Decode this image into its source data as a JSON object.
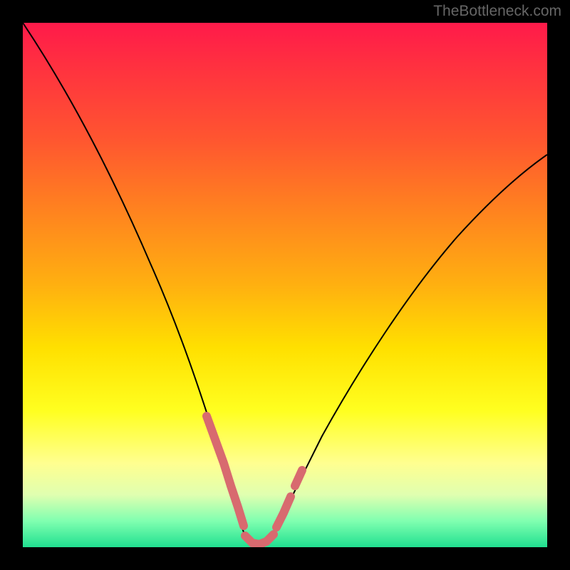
{
  "watermark": "TheBottleneck.com",
  "chart_data": {
    "type": "line",
    "title": "",
    "xlabel": "",
    "ylabel": "",
    "xlim": [
      0,
      100
    ],
    "ylim": [
      0,
      100
    ],
    "grid": false,
    "series": [
      {
        "name": "bottleneck-curve",
        "x": [
          0,
          5,
          10,
          15,
          20,
          25,
          28,
          30,
          32,
          34,
          36,
          38,
          40,
          42,
          44,
          46,
          50,
          55,
          60,
          65,
          70,
          75,
          80,
          85,
          90,
          95,
          100
        ],
        "y": [
          100,
          90,
          79,
          68,
          56,
          43,
          34,
          28,
          22,
          16,
          10,
          5,
          2,
          0,
          0,
          2,
          6,
          12,
          19,
          26,
          33,
          39,
          45,
          50,
          55,
          59,
          63
        ]
      }
    ],
    "markers": [
      {
        "name": "marker-seg-left",
        "x_range": [
          28,
          38
        ],
        "y_range": [
          5,
          16
        ],
        "color": "#d86a6f"
      },
      {
        "name": "marker-seg-bottom",
        "x_range": [
          40,
          46
        ],
        "y_range": [
          0,
          2
        ],
        "color": "#d86a6f"
      },
      {
        "name": "marker-seg-right",
        "x_range": [
          46,
          52
        ],
        "y_range": [
          6,
          12
        ],
        "color": "#d86a6f"
      }
    ],
    "gradient_stops": [
      {
        "pos": 0,
        "color": "#ff1a4a"
      },
      {
        "pos": 50,
        "color": "#ffb010"
      },
      {
        "pos": 75,
        "color": "#ffff20"
      },
      {
        "pos": 100,
        "color": "#20e090"
      }
    ]
  }
}
